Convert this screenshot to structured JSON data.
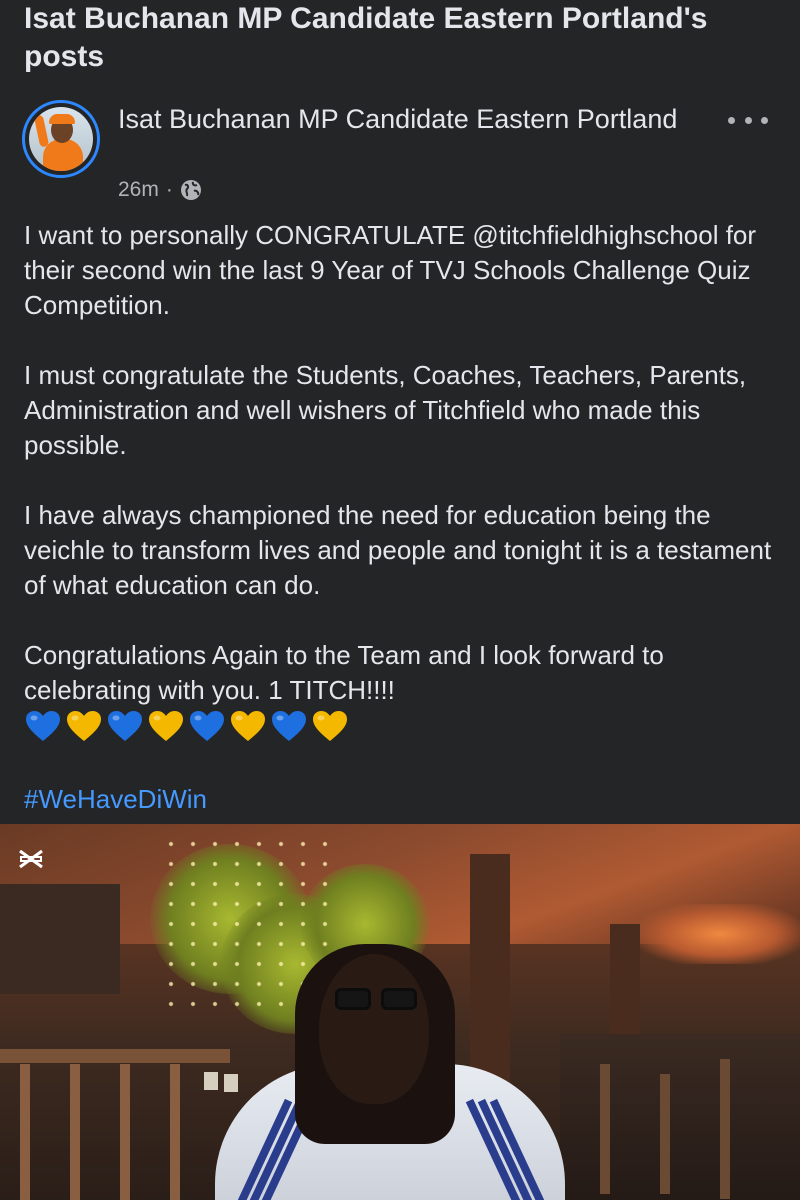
{
  "header": {
    "title": "Isat Buchanan MP Candidate Eastern Portland's posts"
  },
  "post": {
    "author": "Isat Buchanan MP Candidate Eastern Portland",
    "time": "26m",
    "separator": "·",
    "audience_icon": "globe-icon",
    "menu_icon": "more-options-icon",
    "paragraphs": [
      "I want to personally CONGRATULATE @titchfieldhighschool for their second win the last 9 Year of TVJ Schools Challenge Quiz Competition.",
      "I must congratulate the Students, Coaches, Teachers, Parents, Administration and well wishers of Titchfield who made this possible.",
      "I have always championed the need for education being the veichle to transform lives and people and tonight it is a testament of what education can do.",
      "Congratulations Again to the Team and I look forward to celebrating with you. 1 TITCH!!!!"
    ],
    "hearts": [
      "blue-heart",
      "yellow-heart",
      "blue-heart",
      "yellow-heart",
      "blue-heart",
      "yellow-heart",
      "blue-heart",
      "yellow-heart"
    ],
    "hashtag": "#WeHaveDiWin"
  },
  "video": {
    "watermark_icon": "capcut-icon"
  },
  "colors": {
    "background": "#242526",
    "text": "#e4e6eb",
    "secondary_text": "#b0b3b8",
    "link": "#4599ff",
    "avatar_ring": "#2d88ff",
    "blue_heart": "#1e6fe0",
    "yellow_heart": "#f5b800"
  }
}
